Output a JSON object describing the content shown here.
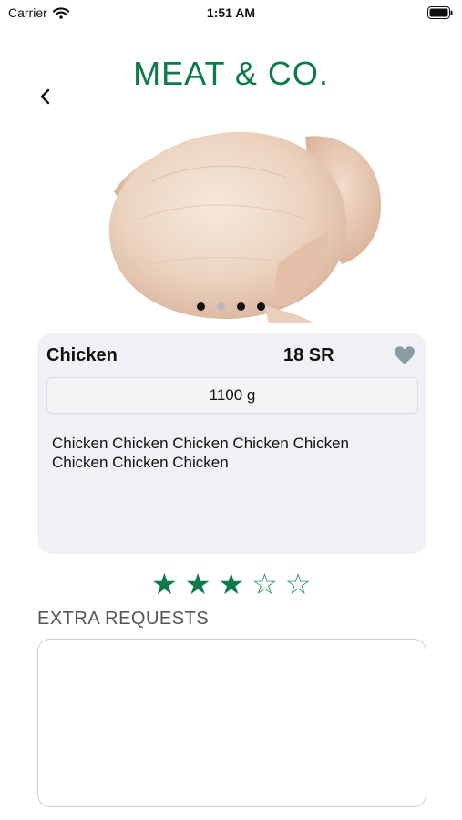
{
  "status_bar": {
    "carrier": "Carrier",
    "time": "1:51 AM"
  },
  "header": {
    "title": "MEAT & CO.",
    "back_icon": "chevron-left-icon"
  },
  "carousel": {
    "image": "whole raw chicken photo",
    "page_count": 4,
    "current_page": 2
  },
  "product": {
    "name": "Chicken",
    "price": "18 SR",
    "weight": "1100 g",
    "description": "Chicken Chicken Chicken Chicken Chicken Chicken Chicken Chicken",
    "favorite_icon": "heart-icon"
  },
  "rating": {
    "value": 3,
    "max": 5
  },
  "extra_requests": {
    "label": "EXTRA REQUESTS",
    "value": ""
  },
  "colors": {
    "brand": "#0e7a4a",
    "card_bg": "#f1f1f5",
    "heart": "#8c9aa3"
  }
}
